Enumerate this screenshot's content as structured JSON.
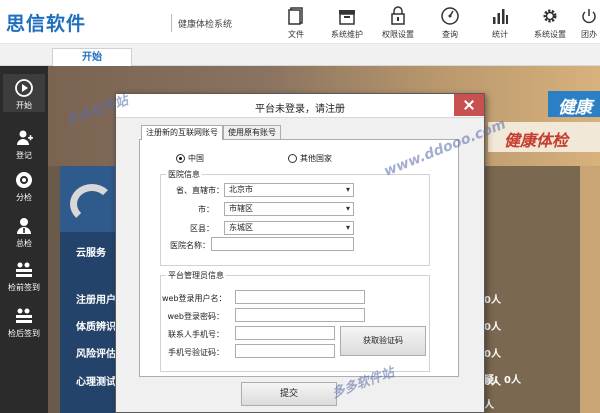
{
  "header": {
    "logo": "思信软件",
    "system_name": "健康体检系统",
    "tools": [
      {
        "label": "文件",
        "icon": "file-icon"
      },
      {
        "label": "系统维护",
        "icon": "folder-icon"
      },
      {
        "label": "权限设置",
        "icon": "lock-icon"
      },
      {
        "label": "查询",
        "icon": "gauge-icon"
      },
      {
        "label": "统计",
        "icon": "bar-chart-icon"
      },
      {
        "label": "系统设置",
        "icon": "gear-icon"
      },
      {
        "label": "团办",
        "icon": "power-icon"
      }
    ]
  },
  "tabs": {
    "start": "开始"
  },
  "sidenav": [
    {
      "label": "开始",
      "icon": "play-icon"
    },
    {
      "label": "登记",
      "icon": "add-user-icon"
    },
    {
      "label": "分检",
      "icon": "camera-icon"
    },
    {
      "label": "总检",
      "icon": "doctor-icon"
    },
    {
      "label": "检前签到",
      "icon": "sign-in-icon"
    },
    {
      "label": "检后签到",
      "icon": "sign-out-icon"
    }
  ],
  "background": {
    "banner_top": "健康",
    "banner_sub": "健康体检",
    "rows": [
      "云服务",
      "注册用户",
      "体质辨识",
      "风险评估",
      "心理测试"
    ],
    "values": [
      "0人",
      "0人",
      "0人",
      "0人",
      "疑：0人",
      "人"
    ]
  },
  "watermark": {
    "line1": "多多软件站",
    "line2": "www.ddooo.com",
    "line3": "多多软件站"
  },
  "dialog": {
    "title": "平台未登录，请注册",
    "tabs": [
      "注册新的互联网账号",
      "使用原有账号"
    ],
    "radio_china": "中国",
    "radio_other": "其他国家",
    "hospital_group": "医院信息",
    "province_label": "省、直辖市：",
    "province_value": "北京市",
    "city_label": "市：",
    "city_value": "市辖区",
    "district_label": "区县：",
    "district_value": "东城区",
    "hospital_name_label": "医院名称：",
    "hospital_name_value": "",
    "admin_group": "平台管理员信息",
    "web_user_label": "web登录用户名：",
    "web_user_value": "",
    "web_pass_label": "web登录密码：",
    "web_pass_value": "",
    "phone_label": "联系人手机号：",
    "phone_value": "",
    "code_label": "手机号验证码：",
    "code_value": "",
    "get_code_button": "获取验证码",
    "submit_button": "提交"
  }
}
